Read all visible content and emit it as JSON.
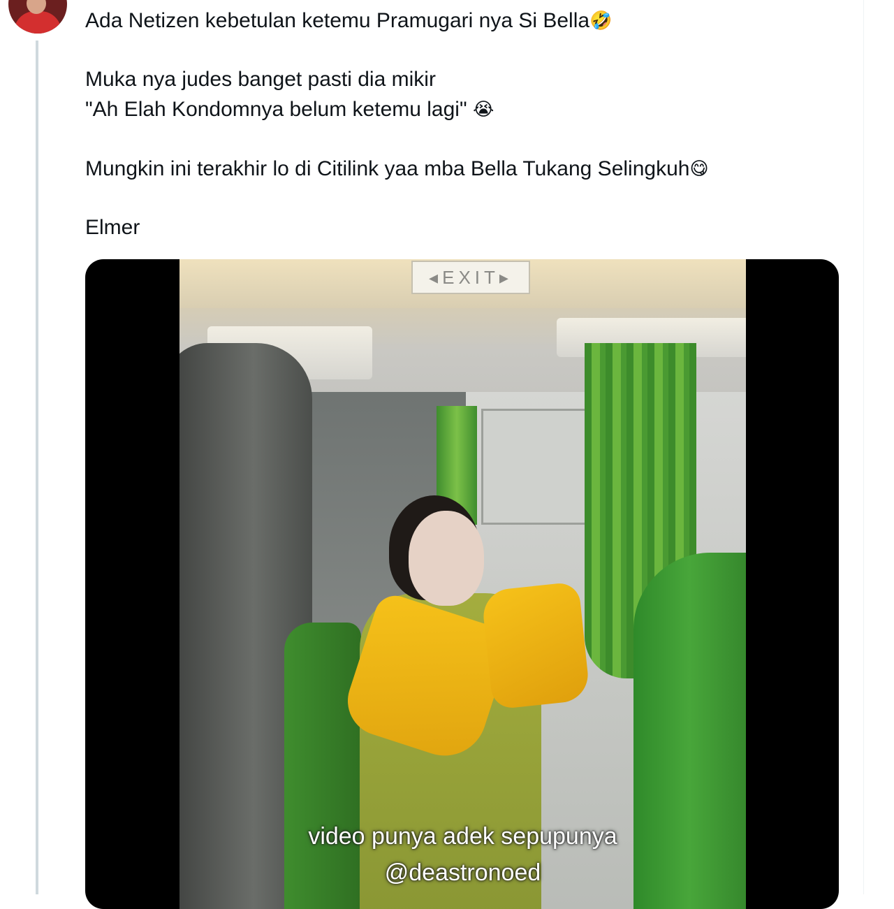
{
  "tweet": {
    "lines": [
      "Ada Netizen kebetulan ketemu  Pramugari nya Si Bella",
      "Muka nya judes banget pasti dia mikir",
      "\"Ah Elah Kondomnya belum ketemu lagi\" ",
      "Mungkin ini terakhir lo di Citilink yaa mba Bella Tukang Selingkuh",
      "Elmer"
    ],
    "emojis": {
      "rofl": "🤣",
      "crying": "😭",
      "yum": "😋"
    }
  },
  "media": {
    "exit_sign": "◂EXIT▸",
    "caption_line1": "video punya adek sepupunya",
    "caption_line2": "@deastronoed"
  },
  "colors": {
    "text": "#0f1419",
    "thread_line": "#cfd9de",
    "media_bg": "#000000",
    "vest": "#f6c21a",
    "uniform": "#a4ad3e",
    "seat_green": "#48a63a"
  }
}
